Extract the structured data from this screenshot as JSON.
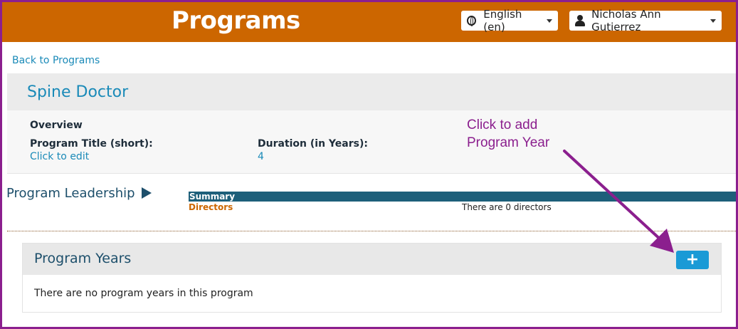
{
  "header": {
    "title": "Programs",
    "language_label": "English (en)",
    "user_name": "Nicholas Ann Gutierrez"
  },
  "nav": {
    "back_link": "Back to Programs"
  },
  "program": {
    "name": "Spine Doctor",
    "overview_label": "Overview",
    "short_title_label": "Program Title (short):",
    "short_title_value": "Click to edit",
    "duration_label": "Duration (in Years):",
    "duration_value": "4"
  },
  "annotation": {
    "line1": "Click to add",
    "line2": "Program Year"
  },
  "leadership": {
    "title": "Program Leadership",
    "summary_label": "Summary",
    "directors_label": "Directors",
    "directors_value": "There are 0 directors"
  },
  "program_years": {
    "title": "Program Years",
    "add_label": "+",
    "empty_message": "There are no program years in this program"
  },
  "colors": {
    "header": "#cc6600",
    "frame": "#8b1f8e",
    "accent": "#1a8ab8",
    "annotation": "#8b1f8e"
  },
  "icons": [
    "globe-icon",
    "user-icon",
    "chevron-down-icon",
    "expand-triangle-icon",
    "plus-icon",
    "annotation-arrow-icon"
  ]
}
